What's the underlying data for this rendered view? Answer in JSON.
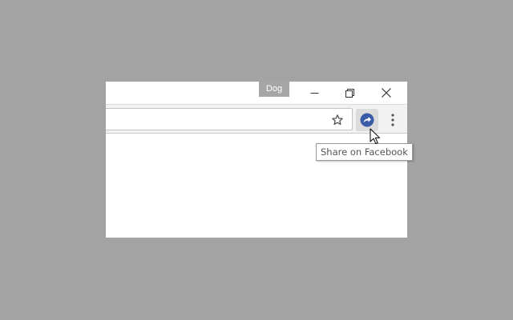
{
  "window": {
    "profile_name": "Dog"
  },
  "toolbar": {
    "bookmark_icon": "star-icon",
    "extension_icon": "share-on-facebook-icon",
    "menu_icon": "vertical-dots-icon"
  },
  "tooltip": {
    "text": "Share on Facebook"
  },
  "colors": {
    "desktop": "#a3a3a3",
    "extension_blue": "#3b5ba8"
  }
}
